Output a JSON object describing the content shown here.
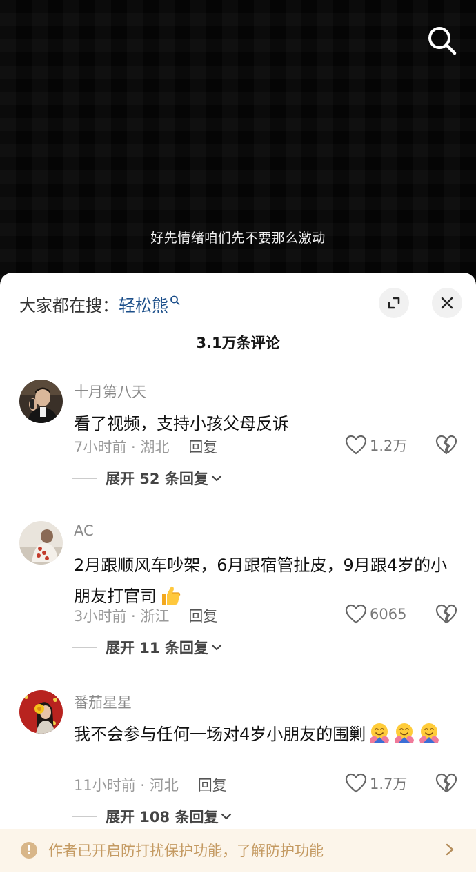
{
  "video": {
    "subtitle": "好先情绪咱们先不要那么激动",
    "search_icon": "search-icon"
  },
  "sheet": {
    "search_hint_prefix": "大家都在搜：",
    "search_hint_term": "轻松熊",
    "comment_count": "3.1万条评论",
    "expand_icon": "expand-icon",
    "close_icon": "close-icon"
  },
  "comments": [
    {
      "user": "十月第八天",
      "text": "看了视频，支持小孩父母反诉",
      "time_location": "7小时前 · 湖北",
      "reply_label": "回复",
      "likes": "1.2万",
      "expand_label": "展开 52 条回复"
    },
    {
      "user": "AC",
      "text": "2月跟顺风车吵架，6月跟宿管扯皮，9月跟4岁的小朋友打官司",
      "emoji": "thumbs-up-emoji",
      "time_location": "3小时前 · 浙江",
      "reply_label": "回复",
      "likes": "6065",
      "expand_label": "展开 11 条回复"
    },
    {
      "user": "番茄星星",
      "text": "我不会参与任何一场对4岁小朋友的围剿",
      "emoji": "hugging-face-emoji",
      "time_location": "11小时前 · 河北",
      "reply_label": "回复",
      "likes": "1.7万",
      "expand_label": "展开 108 条回复"
    }
  ],
  "bottom_bar": {
    "message": "作者已开启防打扰保护功能，了解防护功能",
    "warning_glyph": "!"
  },
  "colors": {
    "accent_link": "#1c4f8a",
    "notice_bg": "#fcf5ea",
    "notice_text": "#c49a62"
  }
}
